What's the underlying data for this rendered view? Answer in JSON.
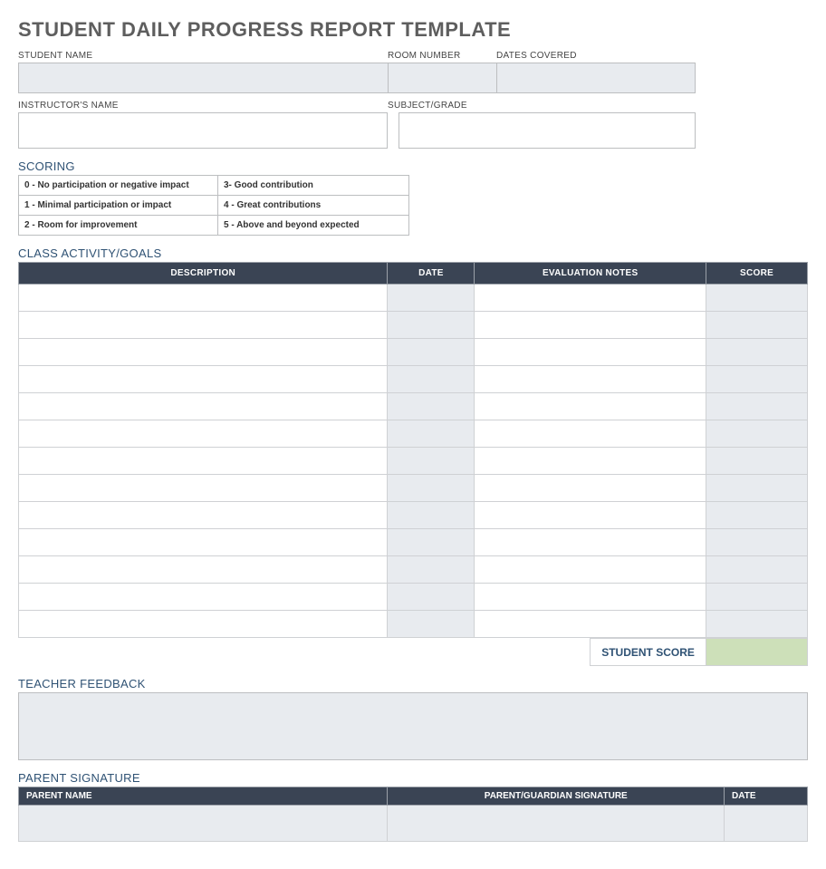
{
  "title": "STUDENT DAILY PROGRESS REPORT TEMPLATE",
  "fields": {
    "student_name_label": "STUDENT NAME",
    "room_number_label": "ROOM NUMBER",
    "dates_covered_label": "DATES COVERED",
    "instructor_name_label": "INSTRUCTOR'S NAME",
    "subject_grade_label": "SUBJECT/GRADE"
  },
  "scoring": {
    "heading": "SCORING",
    "rows": [
      {
        "left": "0 - No participation or negative impact",
        "right": "3- Good contribution"
      },
      {
        "left": "1 - Minimal participation or impact",
        "right": "4 - Great contributions"
      },
      {
        "left": "2 - Room for improvement",
        "right": "5 - Above and beyond expected"
      }
    ]
  },
  "activity": {
    "heading": "CLASS ACTIVITY/GOALS",
    "headers": {
      "description": "DESCRIPTION",
      "date": "DATE",
      "notes": "EVALUATION NOTES",
      "score": "SCORE"
    },
    "row_count": 13,
    "student_score_label": "STUDENT SCORE"
  },
  "feedback": {
    "heading": "TEACHER FEEDBACK"
  },
  "parent": {
    "heading": "PARENT SIGNATURE",
    "headers": {
      "name": "PARENT NAME",
      "signature": "PARENT/GUARDIAN SIGNATURE",
      "date": "DATE"
    }
  }
}
